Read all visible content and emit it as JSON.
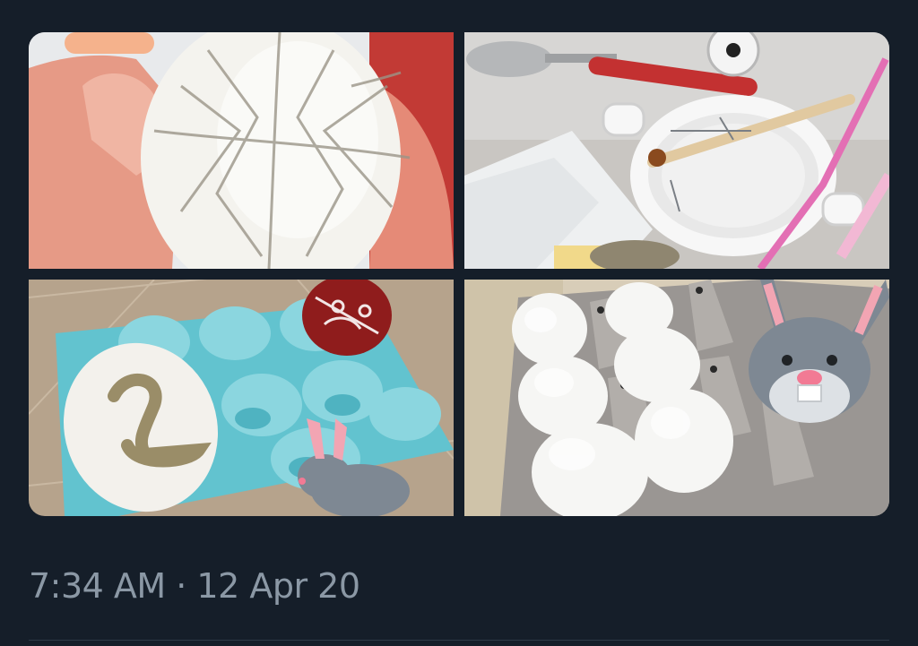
{
  "tweet": {
    "timestamp": "7:34 AM · 12 Apr 20"
  },
  "media": {
    "photos": [
      {
        "subject": "hand holding white egg wrapped with thread lines"
      },
      {
        "subject": "white ramekin with kistka tool, spoon and paper towel"
      },
      {
        "subject": "decorated egg with swan in blue egg tray, bunny sticker"
      },
      {
        "subject": "white eggs in grey egg carton with bunny sticker"
      }
    ]
  },
  "colors": {
    "background": "#151e29",
    "timestamp_text": "#8b98a5"
  }
}
